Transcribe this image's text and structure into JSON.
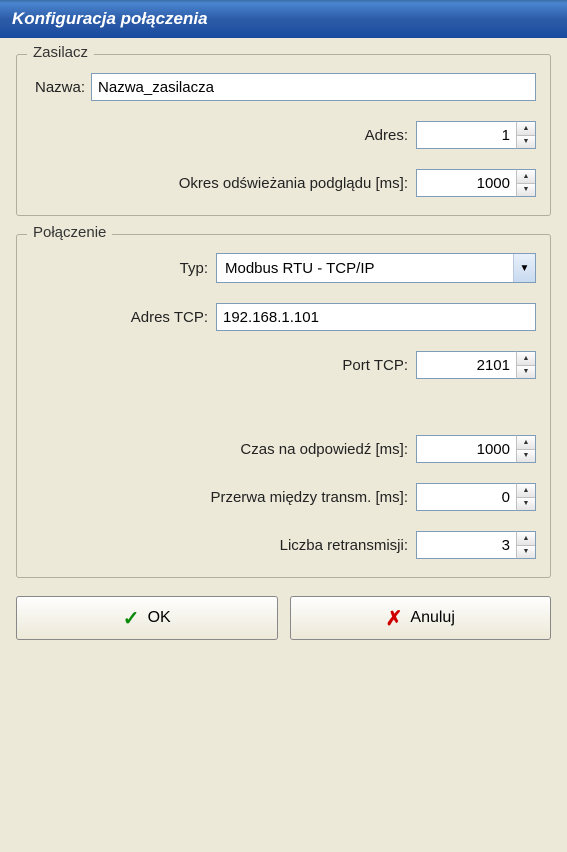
{
  "window": {
    "title": "Konfiguracja połączenia"
  },
  "zasilacz": {
    "legend": "Zasilacz",
    "nazwa_label": "Nazwa:",
    "nazwa_value": "Nazwa_zasilacza",
    "adres_label": "Adres:",
    "adres_value": "1",
    "okres_label": "Okres odświeżania podglądu [ms]:",
    "okres_value": "1000"
  },
  "polaczenie": {
    "legend": "Połączenie",
    "typ_label": "Typ:",
    "typ_value": "Modbus RTU - TCP/IP",
    "adres_tcp_label": "Adres TCP:",
    "adres_tcp_value": "192.168.1.101",
    "port_tcp_label": "Port TCP:",
    "port_tcp_value": "2101",
    "czas_label": "Czas na odpowiedź [ms]:",
    "czas_value": "1000",
    "przerwa_label": "Przerwa między transm. [ms]:",
    "przerwa_value": "0",
    "retrans_label": "Liczba retransmisji:",
    "retrans_value": "3"
  },
  "buttons": {
    "ok": "OK",
    "cancel": "Anuluj"
  }
}
